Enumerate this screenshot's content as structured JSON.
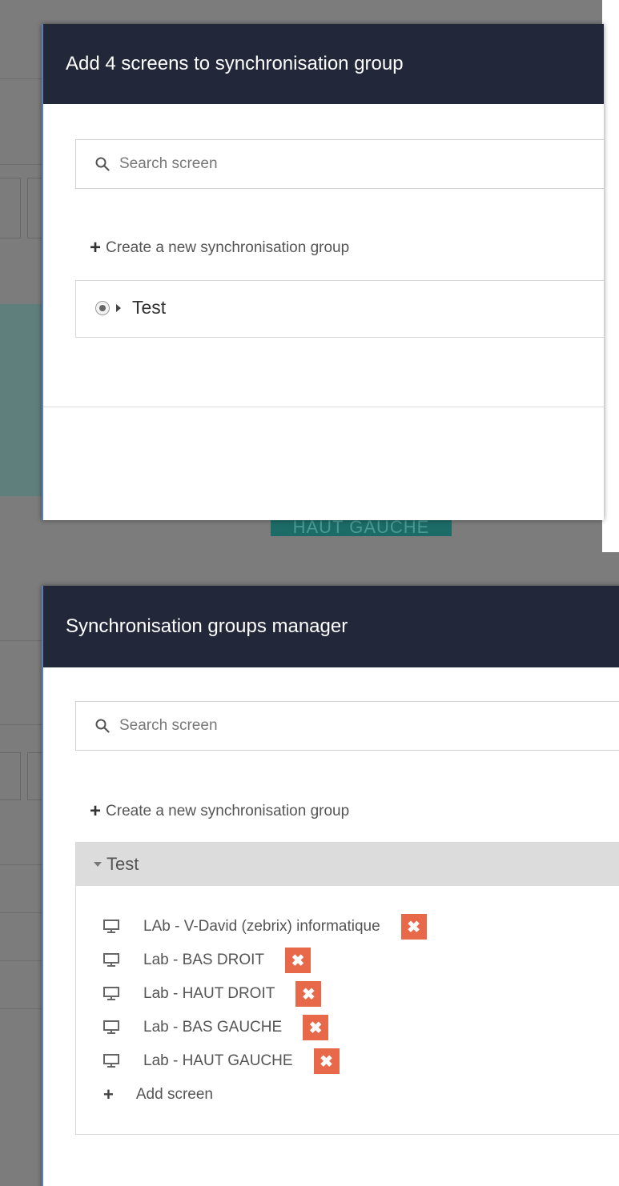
{
  "background": {
    "chip_text": "HAUT GAUCHE"
  },
  "modal_add": {
    "title": "Add 4 screens to synchronisation group",
    "search_placeholder": "Search screen",
    "create_label": "Create a new synchronisation group",
    "groups": [
      {
        "name": "Test",
        "selected": true
      }
    ]
  },
  "modal_manager": {
    "title": "Synchronisation groups manager",
    "search_placeholder": "Search screen",
    "create_label": "Create a new synchronisation group",
    "group": {
      "name": "Test",
      "expanded": true,
      "screens": [
        "LAb - V-David (zebrix) informatique",
        "Lab - BAS DROIT",
        "Lab - HAUT DROIT",
        "Lab - BAS GAUCHE",
        "Lab - HAUT GAUCHE"
      ],
      "remove_symbol": "✖",
      "add_label": "Add screen"
    }
  },
  "colors": {
    "header_bg": "#22273a",
    "remove_btn": "#e8684a",
    "group_header_bg": "#dcdcdc",
    "overlay_bg": "#7c7c7c"
  },
  "icons": [
    "search-icon",
    "plus-icon",
    "radio-icon",
    "caret-right-icon",
    "caret-down-icon",
    "monitor-icon",
    "close-icon"
  ]
}
